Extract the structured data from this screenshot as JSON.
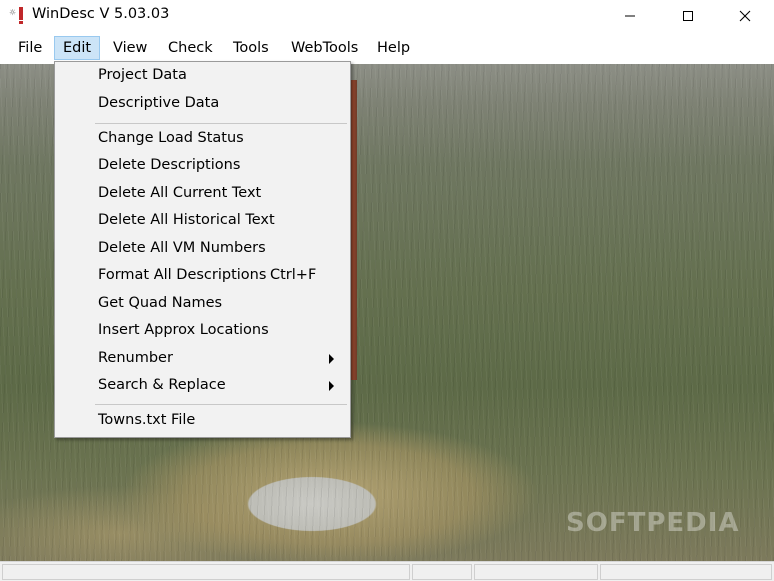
{
  "window": {
    "title": "WinDesc V 5.03.03",
    "controls": [
      "minimize-icon",
      "maximize-icon",
      "close-icon"
    ]
  },
  "menubar": {
    "items": [
      {
        "label": "File"
      },
      {
        "label": "Edit",
        "active": true
      },
      {
        "label": "View"
      },
      {
        "label": "Check"
      },
      {
        "label": "Tools"
      },
      {
        "label": "WebTools"
      },
      {
        "label": "Help"
      }
    ]
  },
  "edit_menu": {
    "items": [
      {
        "label": "Project Data"
      },
      {
        "label": "Descriptive Data"
      },
      {
        "label": "Change Load Status"
      },
      {
        "label": "Delete Descriptions"
      },
      {
        "label": "Delete All Current Text"
      },
      {
        "label": "Delete All Historical Text"
      },
      {
        "label": "Delete All VM Numbers"
      },
      {
        "label": "Format All Descriptions",
        "shortcut": "Ctrl+F"
      },
      {
        "label": "Get Quad Names"
      },
      {
        "label": "Insert Approx Locations"
      },
      {
        "label": "Renumber",
        "submenu": true
      },
      {
        "label": "Search & Replace",
        "submenu": true
      },
      {
        "label": "Towns.txt File"
      }
    ]
  },
  "watermark": "SOFTPEDIA",
  "colors": {
    "menu_active_bg": "#cce4f7",
    "menu_active_border": "#99c9ef",
    "dropdown_bg": "#f2f2f2"
  }
}
